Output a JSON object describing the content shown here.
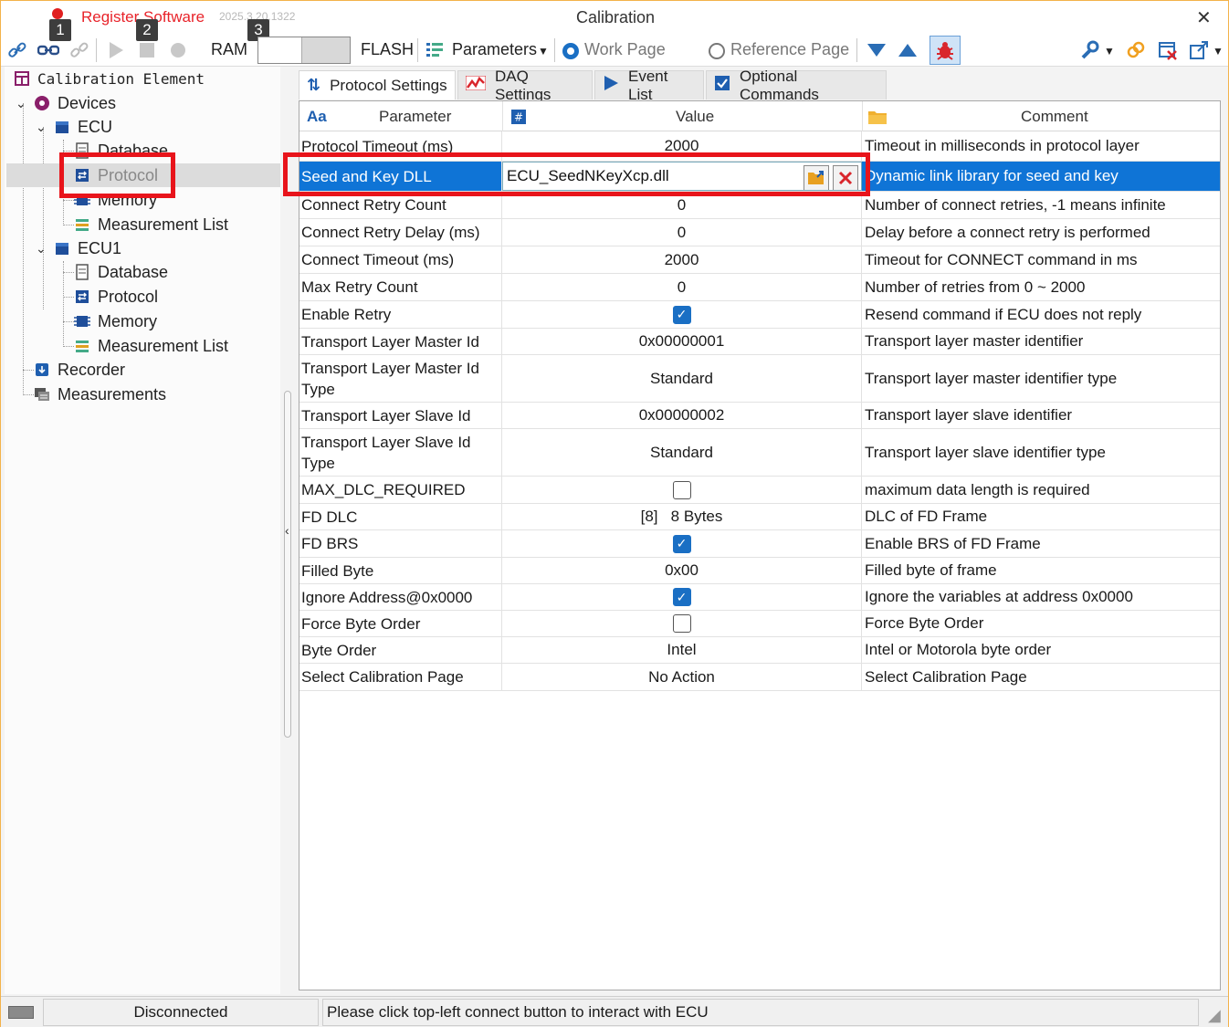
{
  "titlebar": {
    "register_label": "Register Software",
    "version": "2025.3.20.1322",
    "title": "Calibration",
    "close": "✕"
  },
  "toolbar": {
    "badges": [
      "1",
      "2",
      "3"
    ],
    "ram_label": "RAM",
    "flash_label": "FLASH",
    "parameters_label": "Parameters",
    "work_page_label": "Work Page",
    "reference_page_label": "Reference Page",
    "selected_page": "Work Page"
  },
  "tree": {
    "header": "Calibration Element",
    "devices": "Devices",
    "ecu": "ECU",
    "ecu_children": [
      "Database",
      "Protocol",
      "Memory",
      "Measurement List"
    ],
    "ecu1": "ECU1",
    "ecu1_children": [
      "Database",
      "Protocol",
      "Memory",
      "Measurement List"
    ],
    "recorder": "Recorder",
    "measurements": "Measurements"
  },
  "tabs": [
    "Protocol Settings",
    "DAQ Settings",
    "Event List",
    "Optional Commands"
  ],
  "grid": {
    "headers": {
      "icon1": "Aa",
      "parameter": "Parameter",
      "icon2": "#",
      "value": "Value",
      "comment": "Comment"
    },
    "rows": [
      {
        "parameter": "Protocol Timeout (ms)",
        "value": "2000",
        "comment": "Timeout in milliseconds in protocol layer"
      },
      {
        "parameter": "Seed and Key DLL",
        "value": "ECU_SeedNKeyXcp.dll",
        "comment": "Dynamic link library for seed and key"
      },
      {
        "parameter": "Connect Retry Count",
        "value": "0",
        "comment": "Number of connect retries, -1 means infinite"
      },
      {
        "parameter": "Connect Retry Delay (ms)",
        "value": "0",
        "comment": "Delay before a connect retry is performed"
      },
      {
        "parameter": "Connect Timeout (ms)",
        "value": "2000",
        "comment": "Timeout for CONNECT command in ms"
      },
      {
        "parameter": "Max Retry Count",
        "value": "0",
        "comment": "Number of retries from 0 ~ 2000"
      },
      {
        "parameter": "Enable Retry",
        "value": "",
        "checked": true,
        "comment": "Resend command if ECU does not reply"
      },
      {
        "parameter": "Transport Layer Master Id",
        "value": "0x00000001",
        "comment": "Transport layer master identifier"
      },
      {
        "parameter": "Transport Layer Master Id Type",
        "value": "Standard",
        "comment": "Transport layer master identifier type"
      },
      {
        "parameter": "Transport Layer Slave Id",
        "value": "0x00000002",
        "comment": "Transport layer slave identifier"
      },
      {
        "parameter": "Transport Layer Slave Id Type",
        "value": "Standard",
        "comment": "Transport layer slave identifier type"
      },
      {
        "parameter": "MAX_DLC_REQUIRED",
        "value": "",
        "checked": false,
        "comment": "maximum data length is required"
      },
      {
        "parameter": "FD DLC",
        "value": "[8]   8 Bytes",
        "comment": "DLC of FD Frame"
      },
      {
        "parameter": "FD BRS",
        "value": "",
        "checked": true,
        "comment": "Enable BRS of FD Frame"
      },
      {
        "parameter": "Filled Byte",
        "value": "0x00",
        "comment": "Filled byte of frame"
      },
      {
        "parameter": "Ignore Address@0x0000",
        "value": "",
        "checked": true,
        "comment": "Ignore the variables at address 0x0000"
      },
      {
        "parameter": "Force Byte Order",
        "value": "",
        "checked": false,
        "comment": "Force Byte Order"
      },
      {
        "parameter": "Byte Order",
        "value": "Intel",
        "comment": "Intel or Motorola byte order"
      },
      {
        "parameter": "Select Calibration Page",
        "value": "No Action",
        "comment": "Select Calibration Page"
      }
    ]
  },
  "status": {
    "connection": "Disconnected",
    "message": "Please click top-left connect button to interact with ECU"
  },
  "colors": {
    "accent": "#0f74d6",
    "annotation": "#e8141b",
    "register": "#e8232a"
  }
}
